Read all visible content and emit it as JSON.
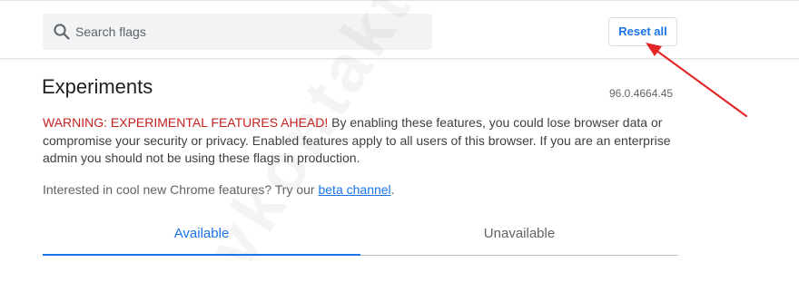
{
  "search": {
    "placeholder": "Search flags"
  },
  "toolbar": {
    "reset_label": "Reset all"
  },
  "main": {
    "title": "Experiments",
    "version": "96.0.4664.45",
    "warning_lead": "WARNING: EXPERIMENTAL FEATURES AHEAD!",
    "warning_body": " By enabling these features, you could lose browser data or compromise your security or privacy. Enabled features apply to all users of this browser. If you are an enterprise admin you should not be using these flags in production.",
    "beta_prefix": "Interested in cool new Chrome features? Try our ",
    "beta_link": "beta channel",
    "beta_suffix": "."
  },
  "tabs": [
    {
      "label": "Available",
      "active": true
    },
    {
      "label": "Unavailable",
      "active": false
    }
  ],
  "watermark_text": "vkontakte",
  "colors": {
    "accent": "#1a73e8",
    "warning": "#c5221f",
    "annotation_arrow": "#e32626"
  },
  "icons": {
    "search": "search-icon"
  }
}
